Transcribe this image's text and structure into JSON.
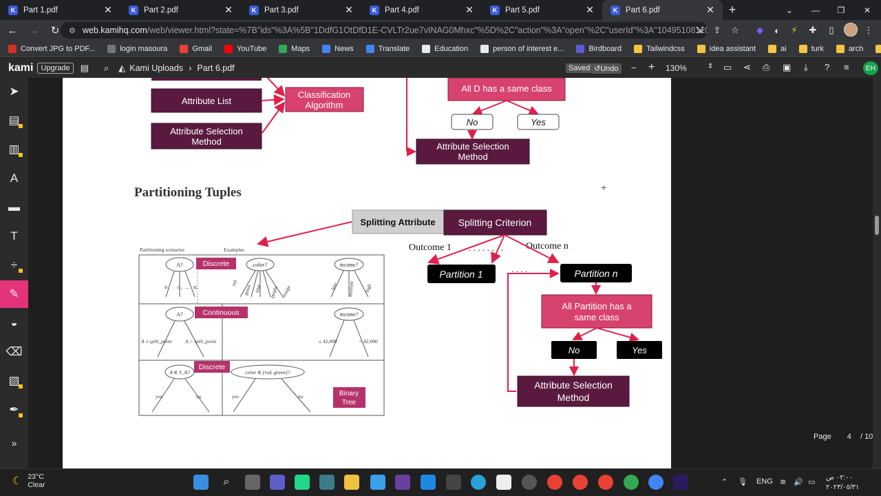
{
  "browser": {
    "tabs": [
      {
        "label": "Part 1.pdf"
      },
      {
        "label": "Part 2.pdf"
      },
      {
        "label": "Part 3.pdf"
      },
      {
        "label": "Part 4.pdf"
      },
      {
        "label": "Part 5.pdf"
      },
      {
        "label": "Part 6.pdf",
        "active": true
      }
    ],
    "url_host": "web.kamihq.com",
    "url_path": "/web/viewer.html?state=%7B\"ids\"%3A%5B\"1DdfG1OtDfD1E-CVLTr2ue7vINAG0Mhxc\"%5D%2C\"action\"%3A\"open\"%2C\"userId\"%3A\"10495108120930722...",
    "profile_initials": "EH"
  },
  "bookmarks": [
    {
      "label": "Convert JPG to PDF...",
      "color": "#d93025"
    },
    {
      "label": "login masoura",
      "color": "#777777"
    },
    {
      "label": "Gmail",
      "color": "#ea4335"
    },
    {
      "label": "YouTube",
      "color": "#ff0000"
    },
    {
      "label": "Maps",
      "color": "#34a853"
    },
    {
      "label": "News",
      "color": "#4285f4"
    },
    {
      "label": "Translate",
      "color": "#4285f4"
    },
    {
      "label": "Education",
      "color": "#e8eaed"
    },
    {
      "label": "person of interest e...",
      "color": "#e8eaed"
    },
    {
      "label": "Birdboard",
      "color": "#5b5bd6"
    },
    {
      "label": "Tailwindcss",
      "color": "#f4c542"
    },
    {
      "label": "idea assistant",
      "color": "#f4c542"
    },
    {
      "label": "ai",
      "color": "#f4c542"
    },
    {
      "label": "turk",
      "color": "#f4c542"
    },
    {
      "label": "arch",
      "color": "#f4c542"
    },
    {
      "label": "networks",
      "color": "#f4c542"
    }
  ],
  "kami": {
    "logo": "kami",
    "upgrade": "Upgrade",
    "breadcrumb_root": "Kami Uploads",
    "breadcrumb_file": "Part 6.pdf",
    "saved": "Saved",
    "undo": "Undo",
    "zoom": "130%",
    "page_label": "Page",
    "page_current": "4",
    "page_total": "/ 10"
  },
  "diagram": {
    "top_left": {
      "attribute_list": "Attribute List",
      "attribute_selection_l1": "Attribute Selection",
      "attribute_selection_l2": "Method",
      "classification_l1": "Classification",
      "classification_l2": "Algorithm"
    },
    "top_right": {
      "all_d": "All D  has a same class",
      "no": "No",
      "yes": "Yes",
      "attr_sel_l1": "Attribute Selection",
      "attr_sel_l2": "Method"
    },
    "section_title": "Partitioning Tuples",
    "splitting_attribute": "Splitting Attribute",
    "splitting_criterion": "Splitting Criterion",
    "outcome_1": "Outcome 1",
    "outcome_n": "Outcome n",
    "dots": ". . . .  . . . .",
    "partition_1": "Partition 1",
    "partition_n": "Partition n",
    "all_partition_l1": "All Partition has a",
    "all_partition_l2": "same class",
    "no": "No",
    "yes": "Yes",
    "attr_sel_l1": "Attribute Selection",
    "attr_sel_l2": "Method",
    "figure": {
      "col1_header": "Partitioning scenarios",
      "col2_header": "Examples",
      "tag_discrete": "Discrete",
      "tag_continuous": "Continuous",
      "tag_discrete2": "Discrete",
      "binary_tree_l1": "Binary",
      "binary_tree_l2": "Tree",
      "a_q": "A?",
      "color_q": "color?",
      "income_q": "income?",
      "a1": "a₁",
      "a2": "a₂",
      "dots": "...",
      "av": "aᵥ",
      "red": "red",
      "green": "green",
      "blue": "blue",
      "purple": "purple",
      "orange": "orange",
      "low": "low",
      "medium": "medium",
      "high": "high",
      "le_split": "A ≤ split_point",
      "gt_split": "A > split_point",
      "le_42": "≤ 42,000",
      "gt_42": "> 42,000",
      "a_in_sa": "A ∈ S_A?",
      "color_in": "color ∈ {red, green}?",
      "yes": "yes",
      "no": "no"
    }
  },
  "taskbar": {
    "temp": "23°C",
    "condition": "Clear",
    "lang": "ENG",
    "time": "٠٢:٠٠ ص",
    "date": "٢٠٢٣/٠٥/٣١"
  },
  "colors": {
    "maroon": "#5a1a3f",
    "pink": "#d8426f",
    "accent": "#e5337b",
    "arrow": "#e0204a"
  }
}
